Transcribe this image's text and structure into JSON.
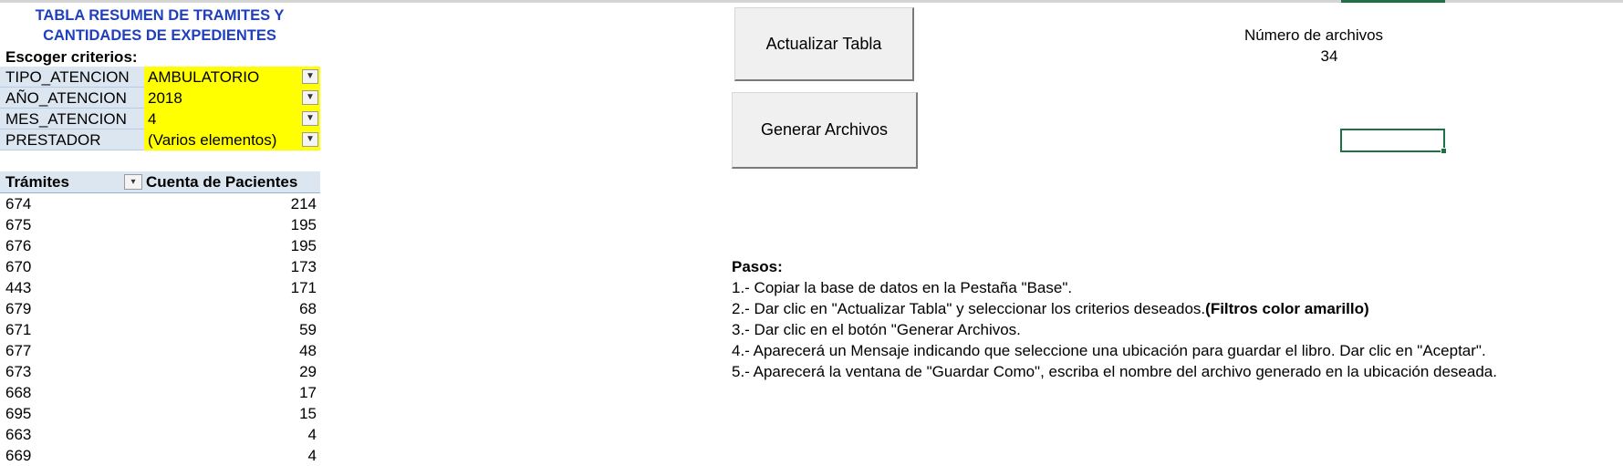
{
  "title": {
    "line1": "TABLA RESUMEN DE TRAMITES Y",
    "line2": "CANTIDADES DE EXPEDIENTES"
  },
  "criteria_label": "Escoger criterios:",
  "filters": [
    {
      "name": "TIPO_ATENCION",
      "value": "AMBULATORIO"
    },
    {
      "name": "AÑO_ATENCION",
      "value": "2018"
    },
    {
      "name": "MES_ATENCION",
      "value": "4"
    },
    {
      "name": "PRESTADOR",
      "value": "(Varios elementos)"
    }
  ],
  "table": {
    "headers": [
      "Trámites",
      "Cuenta de Pacientes"
    ],
    "rows": [
      [
        "674",
        "214"
      ],
      [
        "675",
        "195"
      ],
      [
        "676",
        "195"
      ],
      [
        "670",
        "173"
      ],
      [
        "443",
        "171"
      ],
      [
        "679",
        "68"
      ],
      [
        "671",
        "59"
      ],
      [
        "677",
        "48"
      ],
      [
        "673",
        "29"
      ],
      [
        "668",
        "17"
      ],
      [
        "695",
        "15"
      ],
      [
        "663",
        "4"
      ],
      [
        "669",
        "4"
      ]
    ]
  },
  "buttons": {
    "update": "Actualizar Tabla",
    "generate": "Generar Archivos"
  },
  "file_count": {
    "label": "Número de archivos",
    "value": "34"
  },
  "steps": {
    "heading": "Pasos:",
    "items": [
      "1.- Copiar la base de datos en la Pestaña \"Base\".",
      "2.- Dar clic en \"Actualizar Tabla\" y seleccionar los criterios deseados.",
      "3.- Dar clic en el botón \"Generar Archivos.",
      "4.- Aparecerá un Mensaje indicando que seleccione una ubicación para guardar el libro. Dar clic en \"Aceptar\".",
      "5.- Aparecerá la ventana de \"Guardar Como\", escriba el nombre del archivo generado en la ubicación deseada."
    ],
    "item2_bold": "(Filtros color amarillo)"
  },
  "icons": {
    "filter": "filter-dropdown-icon",
    "sort": "sort-dropdown-icon"
  },
  "colors": {
    "title": "#1f3fbf",
    "filter_value_bg": "#ffff00",
    "header_bg": "#dce6f1",
    "selection": "#1e7145"
  }
}
